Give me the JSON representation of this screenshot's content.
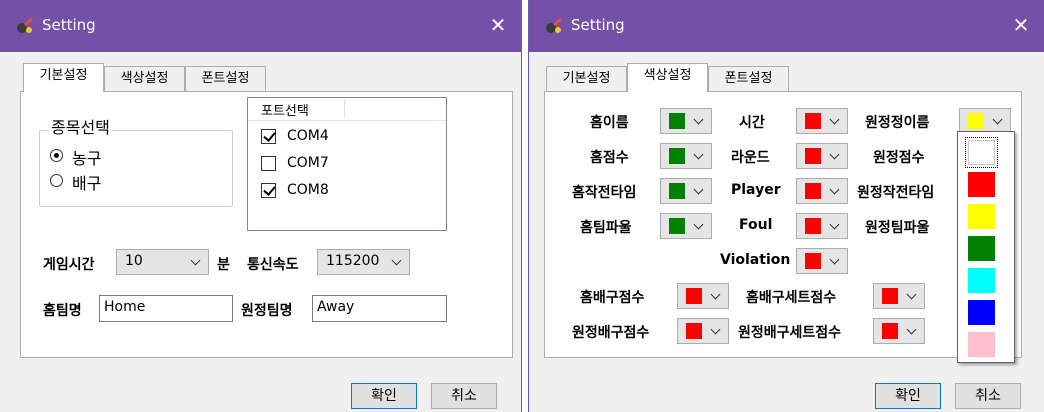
{
  "left": {
    "title": "Setting",
    "tabs": [
      "기본설정",
      "색상설정",
      "폰트설정"
    ],
    "sport_group": {
      "title": "종목선택",
      "options": [
        "농구",
        "배구"
      ],
      "selected": 0
    },
    "port_list": {
      "header": "포트선택",
      "items": [
        {
          "label": "COM4",
          "checked": true
        },
        {
          "label": "COM7",
          "checked": false
        },
        {
          "label": "COM8",
          "checked": true
        }
      ]
    },
    "game_time_label": "게임시간",
    "game_time_value": "10",
    "minute_label": "분",
    "baud_label": "통신속도",
    "baud_value": "115200",
    "home_team_label": "홈팀명",
    "home_team_value": "Home",
    "away_team_label": "원정팀명",
    "away_team_value": "Away",
    "ok_label": "확인",
    "cancel_label": "취소"
  },
  "right": {
    "title": "Setting",
    "tabs": [
      "기본설정",
      "색상설정",
      "폰트설정"
    ],
    "colors": {
      "green": "#008000",
      "red": "#ff0000",
      "yellow": "#ffff00",
      "white": "#ffffff"
    },
    "rows": [
      {
        "label": "홈이름",
        "color": "#008000"
      },
      {
        "label": "시간",
        "color": "#ff0000"
      },
      {
        "label": "원정정이름",
        "color": "#ffff00"
      },
      {
        "label": "홈점수",
        "color": "#008000"
      },
      {
        "label": "라운드",
        "color": "#ff0000"
      },
      {
        "label": "원정점수",
        "color": "#ffffff"
      },
      {
        "label": "홈작전타임",
        "color": "#008000"
      },
      {
        "label": "Player",
        "color": "#ff0000"
      },
      {
        "label": "원정작전타임",
        "color": "#ffffff"
      },
      {
        "label": "홈팀파울",
        "color": "#008000"
      },
      {
        "label": "Foul",
        "color": "#ff0000"
      },
      {
        "label": "원정팀파울",
        "color": "#ffffff"
      },
      {
        "label": "Violation",
        "color": "#ff0000"
      },
      {
        "label": "홈배구점수",
        "color": "#ff0000"
      },
      {
        "label": "홈배구세트점수",
        "color": "#ff0000"
      },
      {
        "label": "원정배구점수",
        "color": "#ff0000"
      },
      {
        "label": "원정배구세트점수",
        "color": "#ff0000"
      }
    ],
    "dropdown_colors": [
      "#ffffff",
      "#ff0000",
      "#ffff00",
      "#008000",
      "#00ffff",
      "#0000ff",
      "#ffc0cb"
    ],
    "ok_label": "확인",
    "cancel_label": "취소"
  }
}
